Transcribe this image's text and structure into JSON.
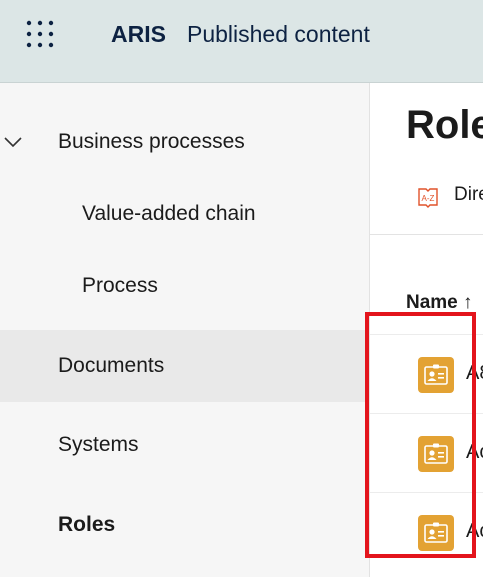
{
  "header": {
    "brand": "ARIS",
    "subtitle": "Published content",
    "apps_icon": "app-launcher-grid-icon"
  },
  "sidebar": {
    "items": [
      {
        "label": "Business processes",
        "expanded": true,
        "icon": "chevron-down-icon"
      },
      {
        "label": "Value-added chain"
      },
      {
        "label": "Process"
      },
      {
        "label": "Documents",
        "selected": true
      },
      {
        "label": "Systems"
      },
      {
        "label": "Roles",
        "active": true
      }
    ]
  },
  "main": {
    "title": "Role",
    "directory_label": "Dire",
    "directory_icon": "az-directory-icon",
    "column_name": "Name",
    "sort_icon": "↑",
    "rows": [
      {
        "label": "A8",
        "icon": "role-badge-icon"
      },
      {
        "label": "Ac",
        "icon": "role-badge-icon"
      },
      {
        "label": "Ac",
        "icon": "role-badge-icon"
      }
    ]
  },
  "colors": {
    "header_bg": "#dce6e6",
    "brand_text": "#0d2242",
    "role_icon": "#e3a233",
    "directory_icon": "#e0522a",
    "highlight": "#e3141c"
  }
}
